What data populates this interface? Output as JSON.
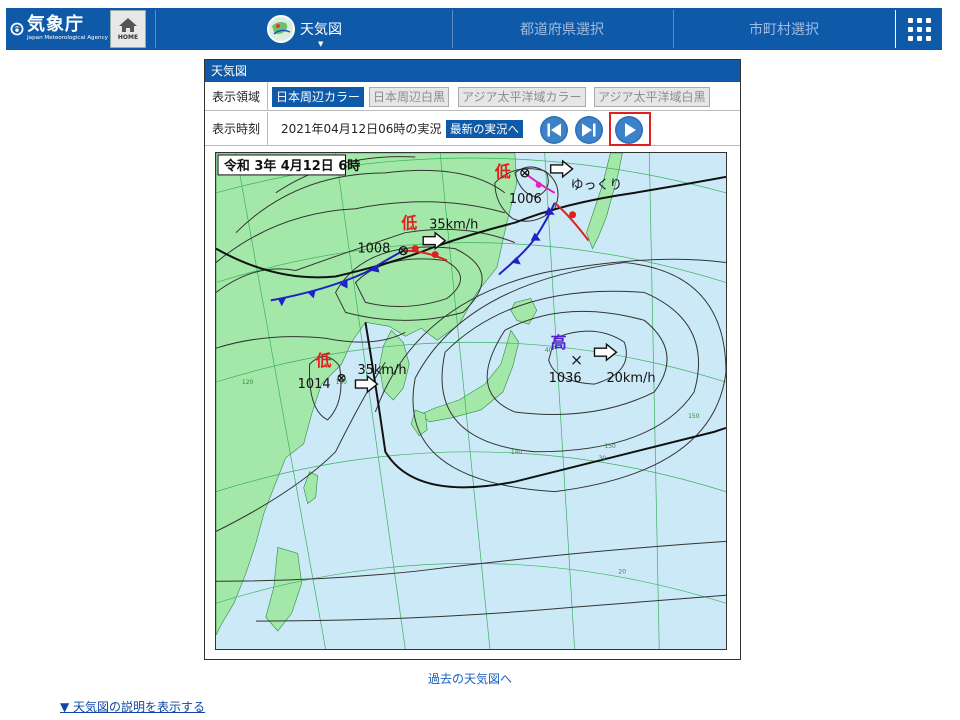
{
  "header": {
    "logo_title": "気象庁",
    "logo_subtitle": "Japan Meteorological Agency",
    "home_label": "HOME",
    "nav": [
      {
        "label": "天気図"
      },
      {
        "label": "都道府県選択"
      },
      {
        "label": "市町村選択"
      }
    ]
  },
  "panel": {
    "title": "天気図",
    "area_label": "表示領域",
    "area_options": [
      {
        "label": "日本周辺カラー",
        "active": true
      },
      {
        "label": "日本周辺白黒",
        "active": false
      },
      {
        "label": "アジア太平洋域カラー",
        "active": false
      },
      {
        "label": "アジア太平洋域白黒",
        "active": false
      }
    ],
    "time_label": "表示時刻",
    "time_value": "2021年04月12日06時の実況",
    "latest_button": "最新の実況へ"
  },
  "map": {
    "date_stamp": "令和 3年 4月12日 6時",
    "low_pressure_glyph": "低",
    "high_pressure_glyph": "高",
    "pressures": [
      "1006",
      "1008",
      "1014",
      "1036"
    ],
    "speeds": [
      "35km/h",
      "35km/h",
      "20km/h"
    ],
    "slow_label": "ゆっくり",
    "grid_labels": [
      "40",
      "140",
      "150",
      "30",
      "20",
      "130",
      "120",
      "150"
    ]
  },
  "links": {
    "past": "過去の天気図へ",
    "explain": "▼ 天気図の説明を表示する"
  },
  "colors": {
    "header_blue": "#0f5aa8",
    "land_green": "#a3e8a8",
    "sea_blue": "#cce9f7",
    "highlight_red": "#e02020",
    "link_blue": "#1560c0"
  }
}
